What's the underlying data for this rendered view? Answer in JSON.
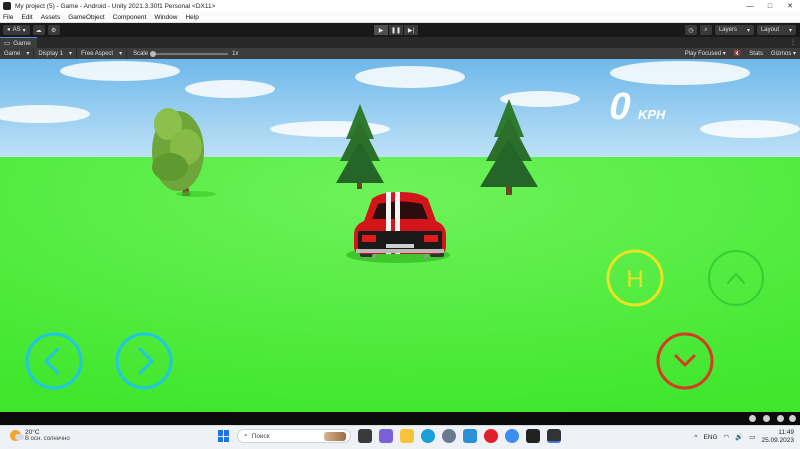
{
  "window": {
    "title": "My project (5) - Game - Android - Unity 2021.3.30f1 Personal <DX11>",
    "minimize": "—",
    "maximize": "□",
    "close": "✕"
  },
  "menu": [
    "File",
    "Edit",
    "Assets",
    "GameObject",
    "Component",
    "Window",
    "Help"
  ],
  "toolbar": {
    "account_label": "AS",
    "layers_label": "Layers",
    "layout_label": "Layout"
  },
  "tab": {
    "label": "Game"
  },
  "game_bar": {
    "mode": "Game",
    "display": "Display 1",
    "aspect": "Free Aspect",
    "scale_label": "Scale",
    "scale_value": "1x",
    "play_mode": "Play Focused",
    "stats": "Stats",
    "gizmos": "Gizmos"
  },
  "hud": {
    "speed_value": "0",
    "speed_unit": "KPH",
    "handbrake_label": "H"
  },
  "taskbar": {
    "temperature": "20°C",
    "weather": "В осн. солнечно",
    "search_placeholder": "Поиск",
    "language": "ENG",
    "time": "11:49",
    "date": "25.09.2023"
  },
  "colors": {
    "sky": "#7ec3ee",
    "grass": "#4cf03a",
    "car_red": "#d4161b",
    "hud_cyan": "#1fc7e3",
    "hud_yellow": "#e8e323",
    "hud_green": "#2fd02f",
    "hud_red": "#d83a22"
  }
}
